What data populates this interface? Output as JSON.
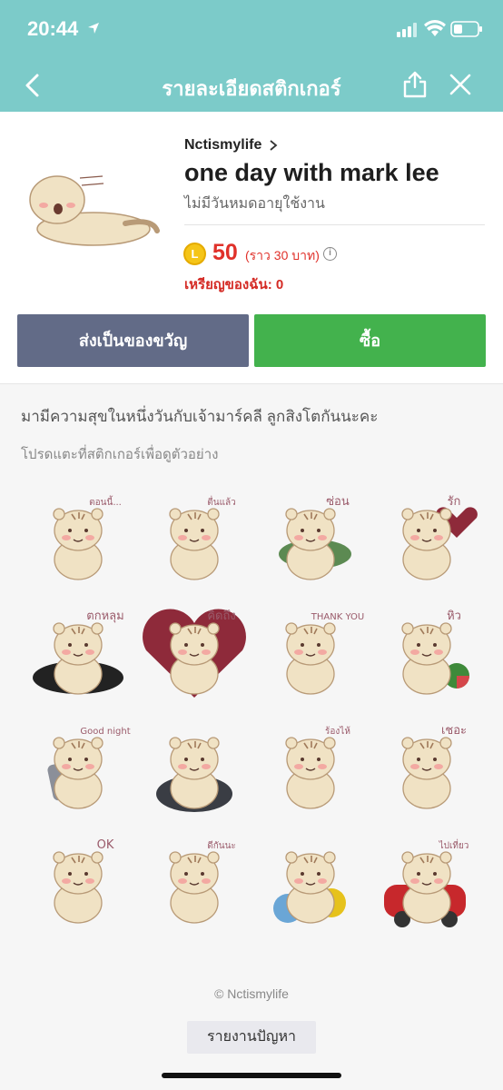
{
  "status": {
    "time": "20:44"
  },
  "nav": {
    "title": "รายละเอียดสติกเกอร์"
  },
  "product": {
    "author": "Nctismylife",
    "title": "one day with mark lee",
    "validity": "ไม่มีวันหมดอายุใช้งาน",
    "coin_letter": "L",
    "price": "50",
    "price_note": "(ราว  30 บาท)",
    "my_coins": "เหรียญของฉัน: 0"
  },
  "buttons": {
    "gift": "ส่งเป็นของขวัญ",
    "buy": "ซื้อ"
  },
  "description": "มามีความสุขในหนึ่งวันกับเจ้ามาร์คลี ลูกสิงโตกันนะคะ",
  "hint": "โปรดแตะที่สติกเกอร์เพื่อดูตัวอย่าง",
  "stickers": [
    {
      "pose": "lying",
      "caption": "ตอนนี้..."
    },
    {
      "pose": "sitting",
      "caption": "ตื่นแล้ว"
    },
    {
      "pose": "bush",
      "caption": "ซ่อน"
    },
    {
      "pose": "hearts",
      "caption": "รัก"
    },
    {
      "pose": "hole",
      "caption": "ตกหลุม"
    },
    {
      "pose": "heart-frame",
      "caption": "คิดถึง"
    },
    {
      "pose": "thank-you",
      "caption": "THANK YOU"
    },
    {
      "pose": "watermelon",
      "caption": "หิว"
    },
    {
      "pose": "good-night",
      "caption": "Good night"
    },
    {
      "pose": "bath",
      "caption": ""
    },
    {
      "pose": "crying",
      "caption": "ร้องไห้"
    },
    {
      "pose": "sad",
      "caption": "เชอะ"
    },
    {
      "pose": "ok",
      "caption": "OK"
    },
    {
      "pose": "dee-kan-na",
      "caption": "ดีกันนะ"
    },
    {
      "pose": "flowers",
      "caption": ""
    },
    {
      "pose": "car",
      "caption": "ไปเที่ยว"
    }
  ],
  "footer": {
    "copyright": "© Nctismylife",
    "report": "รายงานปัญหา"
  },
  "colors": {
    "topbar": "#7ccbc9",
    "price": "#e0312a",
    "gift": "#626b87",
    "buy": "#43b24d"
  }
}
